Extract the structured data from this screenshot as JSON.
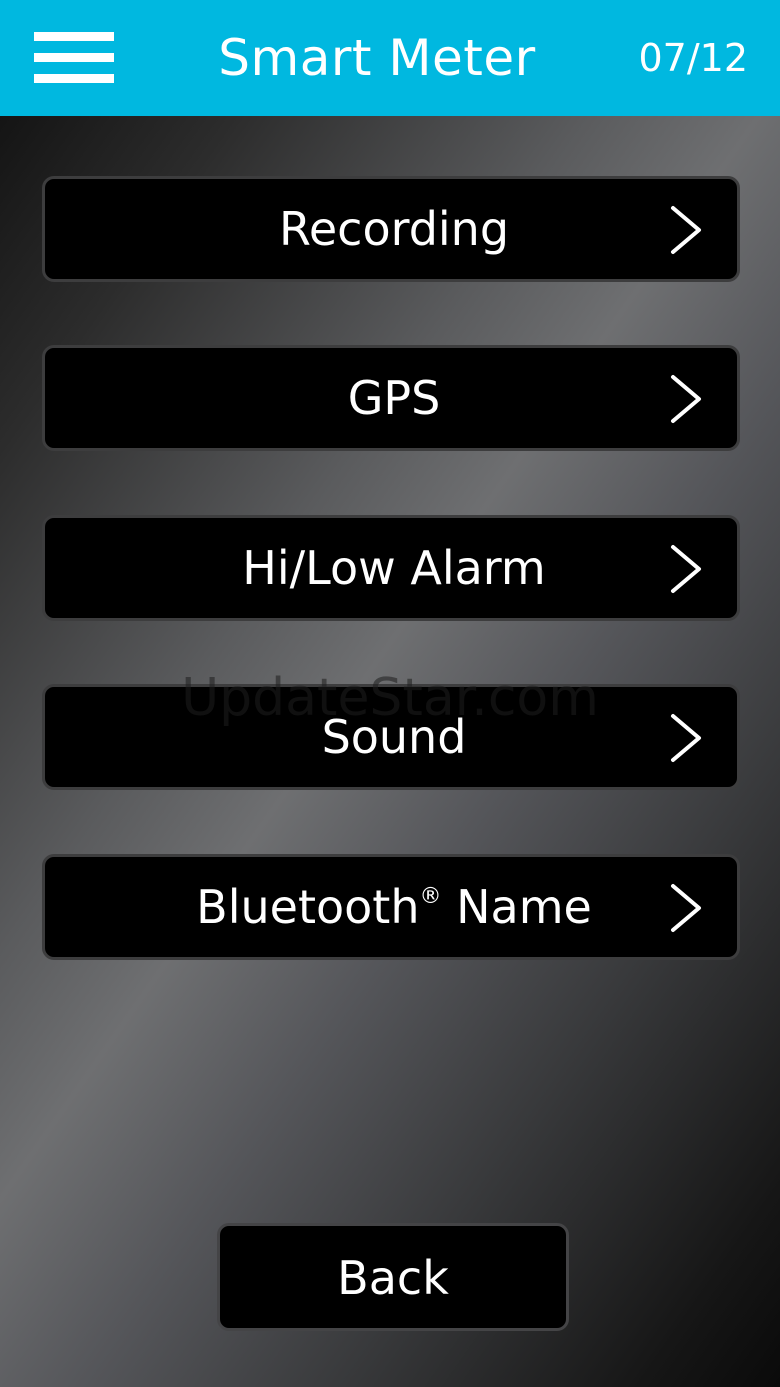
{
  "header": {
    "title": "Smart Meter",
    "page_indicator": "07/12",
    "menu_icon": "hamburger-menu-icon",
    "background_color": "#00b8e0"
  },
  "menu": {
    "items": [
      {
        "label": "Recording",
        "icon": "chevron-right-icon"
      },
      {
        "label": "GPS",
        "icon": "chevron-right-icon"
      },
      {
        "label": "Hi/Low Alarm",
        "icon": "chevron-right-icon"
      },
      {
        "label": "Sound",
        "icon": "chevron-right-icon"
      },
      {
        "label": "Bluetooth",
        "label_suffix": "®",
        "label_tail": " Name",
        "icon": "chevron-right-icon"
      }
    ]
  },
  "watermark": "UpdateStar.com",
  "footer": {
    "back_label": "Back"
  }
}
